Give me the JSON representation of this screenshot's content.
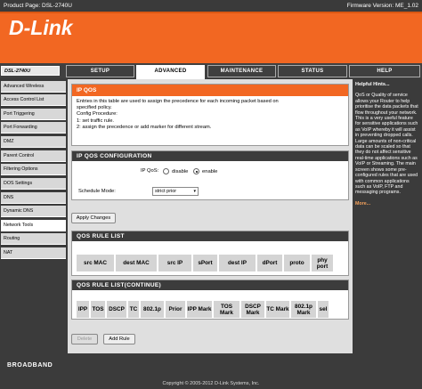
{
  "topbar": {
    "product": "Product Page: DSL-2740U",
    "firmware": "Firmware Version: ME_1.02"
  },
  "brand": {
    "logo": "D-Link",
    "model": "DSL-2740U",
    "accent_color": "#f26722"
  },
  "nav": {
    "tabs": [
      "SETUP",
      "ADVANCED",
      "MAINTENANCE",
      "STATUS",
      "HELP"
    ],
    "active": "ADVANCED"
  },
  "sidebar": {
    "items": [
      "Advanced Wireless",
      "Access Control List",
      "Port Triggering",
      "Port Forwarding",
      "DMZ",
      "Parent Control",
      "Filtering Options",
      "DOS Settings",
      "DNS",
      "Dynamic DNS",
      "Network Tools",
      "Routing",
      "NAT"
    ],
    "active": "Network Tools"
  },
  "ipqos": {
    "title": "IP QOS",
    "line1": "Entries in this table are used to assign the precedence for each incoming packet based on",
    "line2": "specified policy.",
    "line3": "Config Procedure:",
    "line4": "1: set traffic rule.",
    "line5": "2: assign the precedence or add marker for different stream."
  },
  "config": {
    "title": "IP QOS CONFIGURATION",
    "ipqos_label": "IP QoS:",
    "disable_label": "disable",
    "enable_label": "enable",
    "enabled": true,
    "schedule_label": "Schedule Mode:",
    "schedule_value": "strict prior"
  },
  "buttons": {
    "apply": "Apply Changes",
    "delete": "Delete",
    "add_rule": "Add Rule"
  },
  "rule_list": {
    "title": "QOS RULE LIST",
    "columns": [
      "src MAC",
      "dest MAC",
      "src IP",
      "sPort",
      "dest IP",
      "dPort",
      "proto",
      "phy port"
    ]
  },
  "rule_list_cont": {
    "title": "QOS RULE LIST(CONTINUE)",
    "columns": [
      "IPP",
      "TOS",
      "DSCP",
      "TC",
      "802.1p",
      "Prior",
      "IPP Mark",
      "TOS Mark",
      "DSCP Mark",
      "TC Mark",
      "802.1p Mark",
      "sel"
    ]
  },
  "help": {
    "title": "Helpful Hints...",
    "text": "QoS or Quality of service allows your Router to help prioritise the data packets that flow throughout your network. This is a very useful feature for sensitive applications such as VoIP whereby it will assist in preventing dropped calls. Large amounts of non-critical data can be scaled so that they do not affect sensitive real-time applications such as VoIP or Streaming. The main screen shows some pre-configured rules that are used with common applications such as VoIP, FTP and messaging programs.",
    "more": "More..."
  },
  "footer": {
    "broadband": "BROADBAND",
    "copyright": "Copyright © 2005-2012 D-Link Systems, Inc."
  }
}
